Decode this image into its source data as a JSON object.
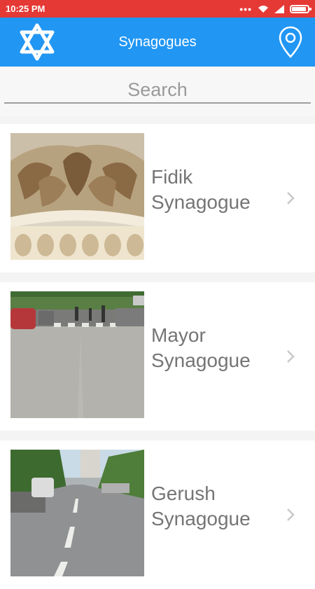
{
  "status": {
    "time": "10:25 PM",
    "dots": "•••",
    "battery_level": 0.85
  },
  "app_bar": {
    "title": "Synagogues",
    "left_icon": "star-of-david-icon",
    "right_icon": "location-pin-icon",
    "color": "#2196f3"
  },
  "search": {
    "placeholder": "Search",
    "value": ""
  },
  "synagogues": [
    {
      "name_line1": "Fidik",
      "name_line2": "Synagogue",
      "image": "carved-stone-capital"
    },
    {
      "name_line1": "Mayor",
      "name_line2": "Synagogue",
      "image": "city-street-crosswalk"
    },
    {
      "name_line1": "Gerush",
      "name_line2": "Synagogue",
      "image": "tree-lined-avenue"
    }
  ],
  "colors": {
    "status_bar": "#e53935",
    "title_text": "#757575",
    "chevron": "#c8c8c8"
  }
}
